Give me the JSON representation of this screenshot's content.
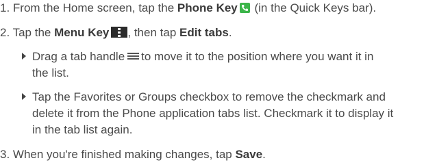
{
  "steps": [
    {
      "number": "1.",
      "pre": " From the Home screen, tap the ",
      "bold": "Phone Key",
      "post": " (in the Quick Keys bar)."
    },
    {
      "number": "2.",
      "pre": " Tap the ",
      "bold": "Menu Key",
      "mid": ", then tap ",
      "bold2": "Edit tabs",
      "post": "."
    },
    {
      "number": "3.",
      "pre": " When you're finished making changes, tap ",
      "bold": "Save",
      "post": "."
    }
  ],
  "subitems": [
    {
      "line1_pre": "Drag a tab handle",
      "line1_post": "to move it to the position where you want it in",
      "line2": "the list."
    },
    {
      "line1": "Tap the Favorites or Groups checkbox to remove the checkmark and",
      "line2": "delete it from the Phone application tabs list. Checkmark it to display it",
      "line3": "in the tab list again."
    }
  ],
  "icons": {
    "phone": "phone-icon",
    "menu": "menu-icon",
    "handle": "tab-handle-icon"
  },
  "colors": {
    "phone_icon": "#3cb54a",
    "menu_icon": "#2b2b2b",
    "text": "#4a4a4a"
  }
}
